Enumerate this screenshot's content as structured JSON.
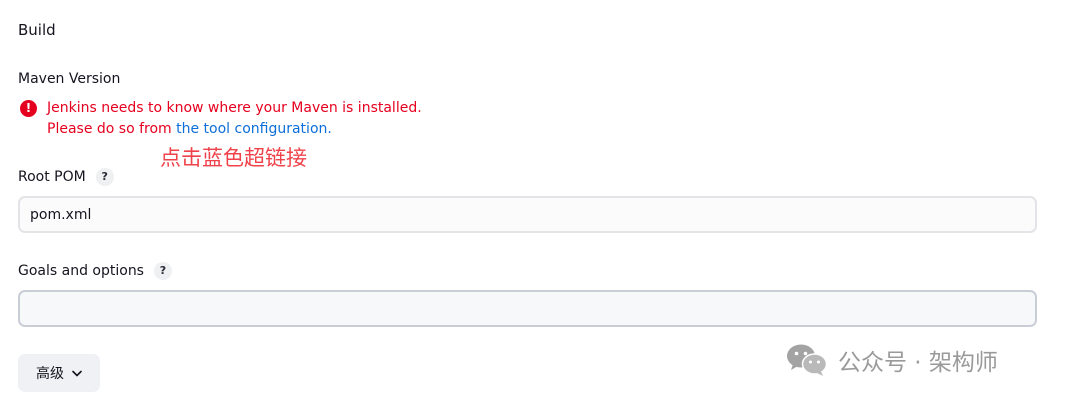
{
  "section": {
    "title": "Build"
  },
  "maven": {
    "label": "Maven Version",
    "error_icon": "!",
    "error_line1": "Jenkins needs to know where your Maven is installed.",
    "error_line2_prefix": "Please do so from ",
    "error_link_text": "the tool configuration",
    "error_line2_suffix": "."
  },
  "annotation": {
    "text": "点击蓝色超链接"
  },
  "root_pom": {
    "label": "Root POM",
    "help": "?",
    "value": "pom.xml"
  },
  "goals": {
    "label": "Goals and options",
    "help": "?",
    "value": ""
  },
  "advanced": {
    "label": "高级",
    "icon": "chevron-down-icon"
  },
  "watermark": {
    "text": "公众号 · 架构师",
    "icon": "wechat-icon"
  },
  "colors": {
    "error": "#e6001f",
    "link": "#0b6ed9",
    "annotation": "#f0424a",
    "watermark": "#9a9a9a"
  }
}
